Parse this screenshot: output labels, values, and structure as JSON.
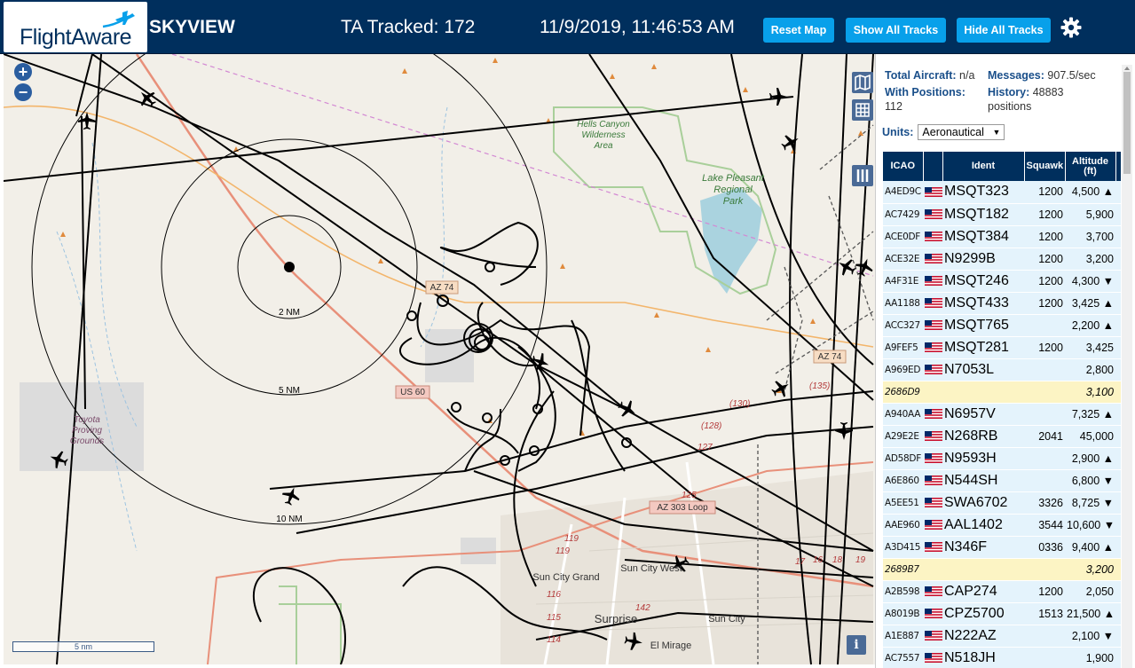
{
  "header": {
    "logo_text": "FlightAware",
    "site_name": "SKYVIEW",
    "tracked": "TA Tracked: 172",
    "clock": "11/9/2019, 11:46:53 AM",
    "buttons": {
      "reset": "Reset Map",
      "show": "Show All Tracks",
      "hide": "Hide All Tracks"
    },
    "settings_icon": "gear-icon"
  },
  "map": {
    "labels": {
      "hells_canyon": "Hells Canyon",
      "wilderness": "Wilderness",
      "area": "Area",
      "lake1": "Lake Pleasant",
      "lake2": "Regional",
      "lake3": "Park",
      "toyota1": "Toyota",
      "toyota2": "Proving",
      "toyota3": "Grounds",
      "sun_city_grand": "Sun City Grand",
      "sun_city_west": "Sun City West",
      "sun_city": "Sun City",
      "surprise": "Surprise",
      "el_mirage": "El Mirage"
    },
    "range_rings": {
      "r2": "2 NM",
      "r5": "5 NM",
      "r10": "10 NM"
    },
    "shields": {
      "az74a": "AZ 74",
      "az74b": "AZ 74",
      "us60": "US 60",
      "az303": "AZ 303 Loop"
    },
    "road_numbers": {
      "n130": "(130)",
      "n135": "(135)",
      "n128": "(128)",
      "n127": "127",
      "n125": "125",
      "n119a": "119",
      "n119b": "119",
      "n116": "116",
      "n115": "115",
      "n114": "114",
      "n142": "142",
      "n17": "17",
      "n16": "16",
      "n18": "18",
      "n19": "19"
    },
    "zoom_in": "+",
    "zoom_out": "−",
    "scale": "5 nm",
    "info": "i"
  },
  "panel": {
    "stats": {
      "total_label": "Total Aircraft:",
      "total_value": "n/a",
      "messages_label": "Messages:",
      "messages_value": "907.5/sec",
      "positions_label": "With Positions:",
      "positions_value": "112",
      "history_label": "History:",
      "history_value": "48883",
      "history_unit": "positions"
    },
    "units_label": "Units:",
    "units_value": "Aeronautical",
    "columns": {
      "icao": "ICAO",
      "flag": "",
      "ident": "Ident",
      "squawk": "Squawk",
      "alt": "Altitude",
      "alt_unit": "(ft)"
    },
    "rows": [
      {
        "icao": "A4ED9C",
        "flag": true,
        "ident": "MSQT323",
        "squawk": "1200",
        "alt": "4,500 ▲",
        "hl": false
      },
      {
        "icao": "AC7429",
        "flag": true,
        "ident": "MSQT182",
        "squawk": "1200",
        "alt": "5,900",
        "hl": false
      },
      {
        "icao": "ACE0DF",
        "flag": true,
        "ident": "MSQT384",
        "squawk": "1200",
        "alt": "3,700",
        "hl": false
      },
      {
        "icao": "ACE32E",
        "flag": true,
        "ident": "N9299B",
        "squawk": "1200",
        "alt": "3,200",
        "hl": false
      },
      {
        "icao": "A4F31E",
        "flag": true,
        "ident": "MSQT246",
        "squawk": "1200",
        "alt": "4,300 ▼",
        "hl": false
      },
      {
        "icao": "AA1188",
        "flag": true,
        "ident": "MSQT433",
        "squawk": "1200",
        "alt": "3,425 ▲",
        "hl": false
      },
      {
        "icao": "ACC327",
        "flag": true,
        "ident": "MSQT765",
        "squawk": "",
        "alt": "2,200 ▲",
        "hl": false
      },
      {
        "icao": "A9FEF5",
        "flag": true,
        "ident": "MSQT281",
        "squawk": "1200",
        "alt": "3,425",
        "hl": false
      },
      {
        "icao": "A969ED",
        "flag": true,
        "ident": "N7053L",
        "squawk": "",
        "alt": "2,800",
        "hl": false
      },
      {
        "icao": "2686D9",
        "flag": false,
        "ident": "",
        "squawk": "",
        "alt": "3,100",
        "hl": true
      },
      {
        "icao": "A940AA",
        "flag": true,
        "ident": "N6957V",
        "squawk": "",
        "alt": "7,325 ▲",
        "hl": false
      },
      {
        "icao": "A29E2E",
        "flag": true,
        "ident": "N268RB",
        "squawk": "2041",
        "alt": "45,000",
        "hl": false
      },
      {
        "icao": "AD58DF",
        "flag": true,
        "ident": "N9593H",
        "squawk": "",
        "alt": "2,900 ▲",
        "hl": false
      },
      {
        "icao": "A6E860",
        "flag": true,
        "ident": "N544SH",
        "squawk": "",
        "alt": "6,800 ▼",
        "hl": false
      },
      {
        "icao": "A5EE51",
        "flag": true,
        "ident": "SWA6702",
        "squawk": "3326",
        "alt": "8,725 ▼",
        "hl": false
      },
      {
        "icao": "AAE960",
        "flag": true,
        "ident": "AAL1402",
        "squawk": "3544",
        "alt": "10,600 ▼",
        "hl": false
      },
      {
        "icao": "A3D415",
        "flag": true,
        "ident": "N346F",
        "squawk": "0336",
        "alt": "9,400 ▲",
        "hl": false
      },
      {
        "icao": "2689B7",
        "flag": false,
        "ident": "",
        "squawk": "",
        "alt": "3,200",
        "hl": true
      },
      {
        "icao": "A2B598",
        "flag": true,
        "ident": "CAP274",
        "squawk": "1200",
        "alt": "2,050",
        "hl": false
      },
      {
        "icao": "A8019B",
        "flag": true,
        "ident": "CPZ5700",
        "squawk": "1513",
        "alt": "21,500 ▲",
        "hl": false
      },
      {
        "icao": "A1E887",
        "flag": true,
        "ident": "N222AZ",
        "squawk": "",
        "alt": "2,100 ▼",
        "hl": false
      },
      {
        "icao": "AC7557",
        "flag": true,
        "ident": "N518JH",
        "squawk": "",
        "alt": "1,900",
        "hl": false
      }
    ]
  },
  "colors": {
    "header": "#002f5d",
    "button": "#08a0ea",
    "row": "#e4f3fc",
    "row_highlight": "#fcf4c4"
  }
}
